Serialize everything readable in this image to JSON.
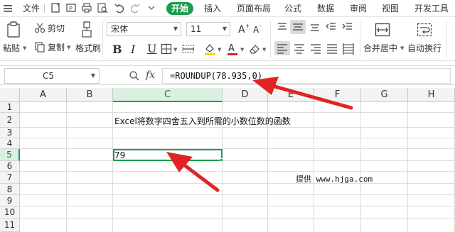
{
  "menubar": {
    "file_label": "文件",
    "tabs": [
      "开始",
      "插入",
      "页面布局",
      "公式",
      "数据",
      "审阅",
      "视图",
      "开发工具"
    ],
    "active_tab": "开始"
  },
  "ribbon": {
    "cut_label": "剪切",
    "paste_label": "粘贴",
    "copy_label": "复制",
    "format_painter_label": "格式刷",
    "font_name": "宋体",
    "font_size": "11",
    "bold_label": "B",
    "italic_label": "I",
    "underline_label": "U",
    "merge_label": "合并居中",
    "wrap_label": "自动换行",
    "font_color": "#e02020",
    "fill_color": "#ffd200"
  },
  "formula_bar": {
    "cell_ref": "C5",
    "fx_label": "fx",
    "formula": "=ROUNDUP(78.935,0)"
  },
  "sheet": {
    "columns": [
      "A",
      "B",
      "C",
      "D",
      "E",
      "F",
      "G",
      "H"
    ],
    "selected_column": "C",
    "rows": [
      "1",
      "2",
      "3",
      "4",
      "5",
      "6",
      "7",
      "8",
      "9",
      "10",
      "11"
    ],
    "selected_row": "5",
    "c2_text": "Excel将数字四舍五入到所需的小数位数的函数",
    "c5_value": "79",
    "watermark": "提供 www.hjga.com"
  },
  "colors": {
    "accent": "#1b9d4f",
    "arrow": "#e02424"
  }
}
